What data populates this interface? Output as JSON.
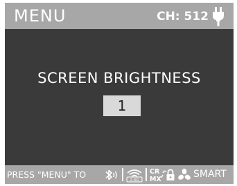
{
  "header": {
    "title": "MENU",
    "channel": "CH: 512",
    "power_icon": "plug-icon"
  },
  "main": {
    "setting_label": "SCREEN BRIGHTNESS",
    "value": "1"
  },
  "footer": {
    "hint": "PRESS \"MENU\" TO",
    "icons": [
      "bluetooth-icon",
      "wireless-2.4g-icon",
      "crmx-icon",
      "lock-icon",
      "fan-icon"
    ],
    "wireless_badge": "2.4G",
    "crmx_top": "CR",
    "crmx_bottom": "MX",
    "fan_mode": "SMART"
  },
  "colors": {
    "bar": "#a7a7a7",
    "background": "#3a3a3a",
    "value_box": "#d9d9d9",
    "text": "#ffffff"
  }
}
